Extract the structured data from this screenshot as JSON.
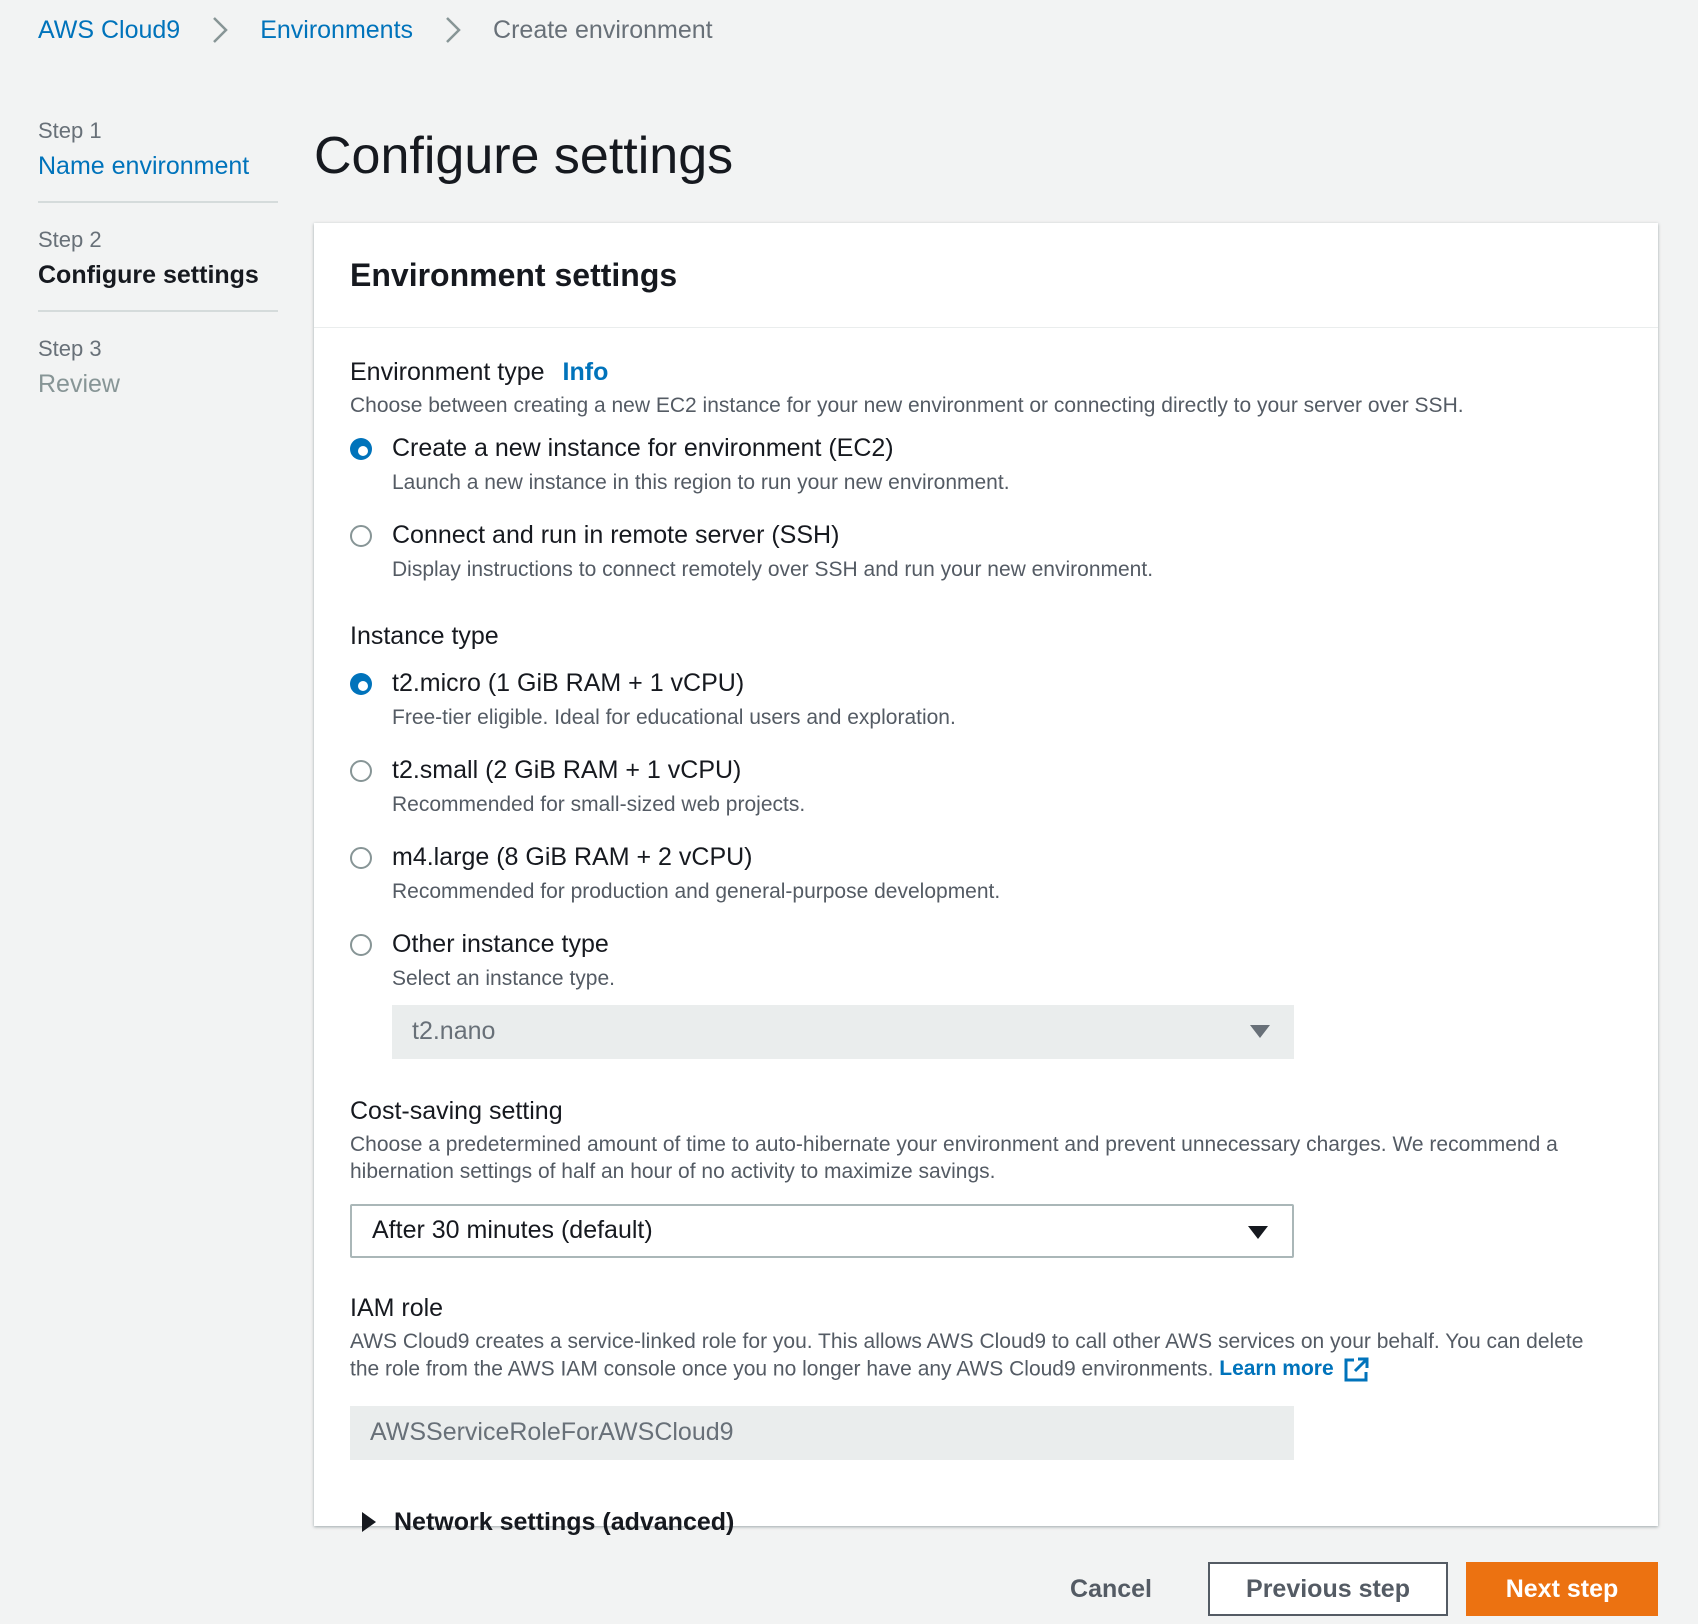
{
  "breadcrumb": {
    "items": [
      {
        "label": "AWS Cloud9"
      },
      {
        "label": "Environments"
      },
      {
        "label": "Create environment"
      }
    ]
  },
  "steps": [
    {
      "number": "Step 1",
      "name": "Name environment",
      "state": "link"
    },
    {
      "number": "Step 2",
      "name": "Configure settings",
      "state": "active"
    },
    {
      "number": "Step 3",
      "name": "Review",
      "state": "disabled"
    }
  ],
  "page": {
    "title": "Configure settings"
  },
  "panel": {
    "title": "Environment settings",
    "environment_type": {
      "label": "Environment type",
      "info": "Info",
      "description": "Choose between creating a new EC2 instance for your new environment or connecting directly to your server over SSH.",
      "options": [
        {
          "label": "Create a new instance for environment (EC2)",
          "description": "Launch a new instance in this region to run your new environment.",
          "checked": true
        },
        {
          "label": "Connect and run in remote server (SSH)",
          "description": "Display instructions to connect remotely over SSH and run your new environment.",
          "checked": false
        }
      ]
    },
    "instance_type": {
      "label": "Instance type",
      "options": [
        {
          "label": "t2.micro (1 GiB RAM + 1 vCPU)",
          "description": "Free-tier eligible. Ideal for educational users and exploration.",
          "checked": true
        },
        {
          "label": "t2.small (2 GiB RAM + 1 vCPU)",
          "description": "Recommended for small-sized web projects.",
          "checked": false
        },
        {
          "label": "m4.large (8 GiB RAM + 2 vCPU)",
          "description": "Recommended for production and general-purpose development.",
          "checked": false
        },
        {
          "label": "Other instance type",
          "description": "Select an instance type.",
          "checked": false
        }
      ],
      "other_select_value": "t2.nano"
    },
    "cost_saving": {
      "label": "Cost-saving setting",
      "description": "Choose a predetermined amount of time to auto-hibernate your environment and prevent unnecessary charges. We recommend a hibernation settings of half an hour of no activity to maximize savings.",
      "value": "After 30 minutes (default)"
    },
    "iam_role": {
      "label": "IAM role",
      "description": "AWS Cloud9 creates a service-linked role for you. This allows AWS Cloud9 to call other AWS services on your behalf. You can delete the role from the AWS IAM console once you no longer have any AWS Cloud9 environments.",
      "learn_more": "Learn more",
      "value": "AWSServiceRoleForAWSCloud9"
    },
    "network_settings": {
      "label": "Network settings (advanced)"
    }
  },
  "actions": {
    "cancel": "Cancel",
    "previous": "Previous step",
    "next": "Next step"
  },
  "colors": {
    "link": "#0073bb",
    "primary": "#ec7211",
    "background": "#f2f3f3"
  }
}
